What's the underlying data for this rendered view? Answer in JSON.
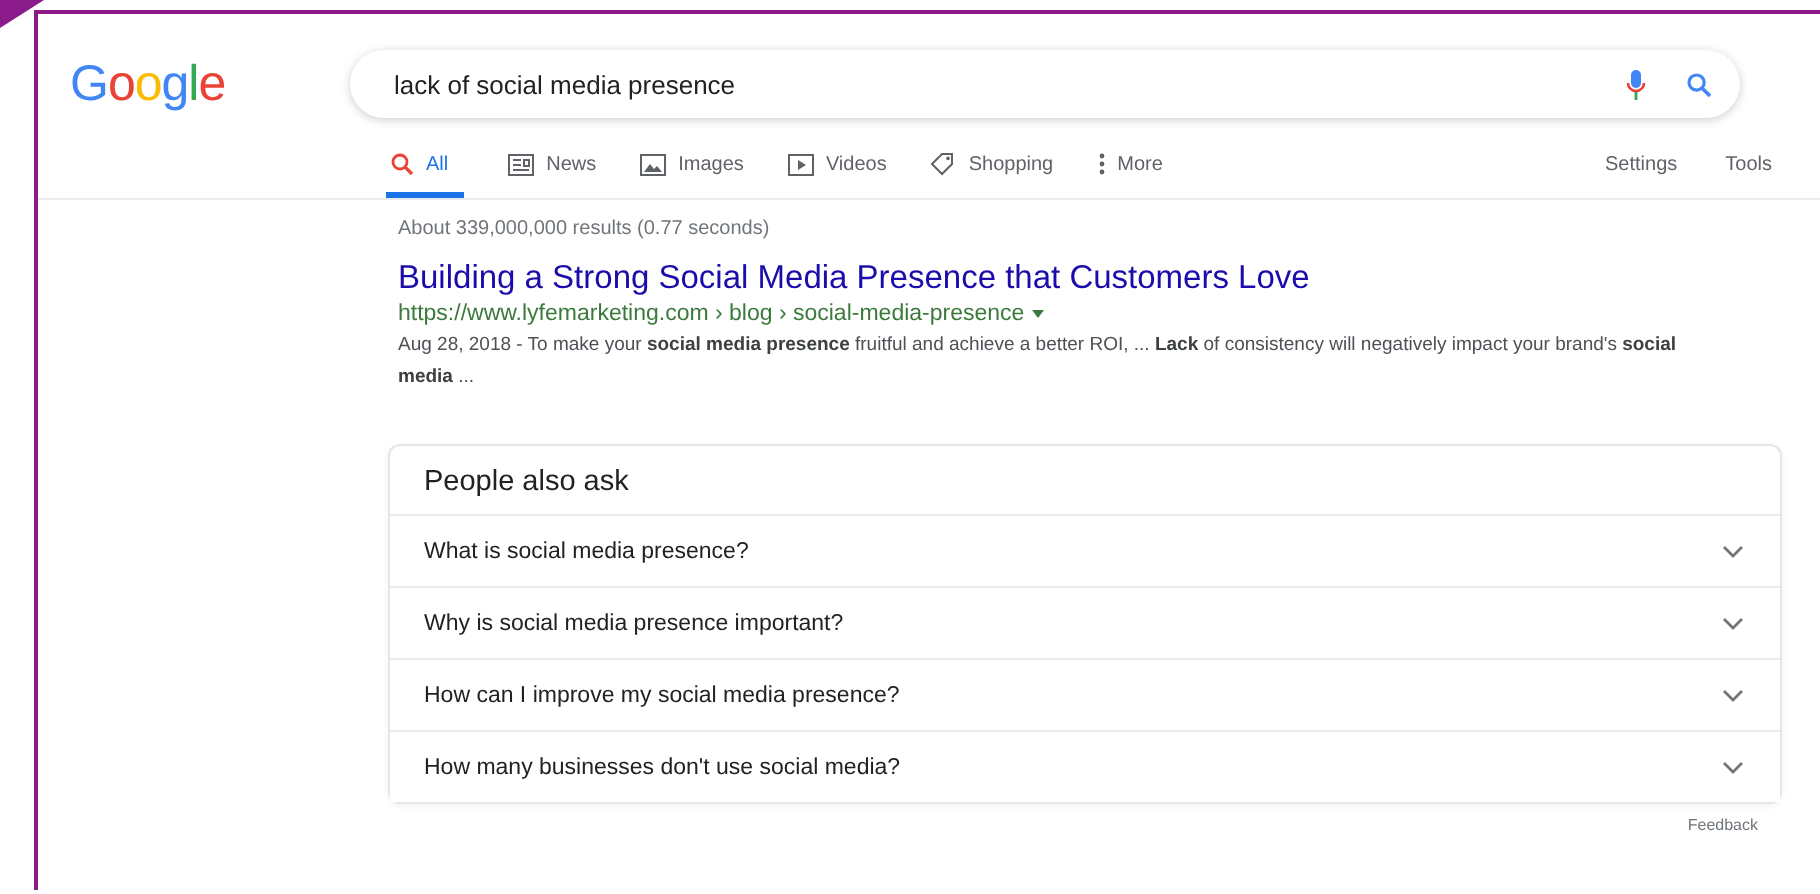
{
  "logo": "Google",
  "search": {
    "value": "lack of social media presence"
  },
  "tabs": [
    {
      "label": "All",
      "kind": "search",
      "selected": true
    },
    {
      "label": "News",
      "kind": "news",
      "selected": false
    },
    {
      "label": "Images",
      "kind": "images",
      "selected": false
    },
    {
      "label": "Videos",
      "kind": "videos",
      "selected": false
    },
    {
      "label": "Shopping",
      "kind": "tag",
      "selected": false
    },
    {
      "label": "More",
      "kind": "dots",
      "selected": false
    }
  ],
  "tools": [
    "Settings",
    "Tools"
  ],
  "result_stats": "About 339,000,000 results (0.77 seconds)",
  "result": {
    "title": "Building a Strong Social Media Presence that Customers Love",
    "url": "https://www.lyfemarketing.com › blog › social-media-presence",
    "snippet": "Aug 28, 2018 - To make your **social media presence** fruitful and achieve a better ROI, ... **Lack** of consistency will negatively impact your brand's **social media** ..."
  },
  "people_also_ask": {
    "title": "People also ask",
    "questions": [
      {
        "text": "What is social media presence?",
        "expanded": false
      },
      {
        "text": "Why is social media presence important?",
        "expanded": false
      },
      {
        "text": "How can I improve my social media presence?",
        "expanded": false
      },
      {
        "text": "How many businesses don't use social media?",
        "expanded": false
      }
    ]
  },
  "feedback": "Feedback"
}
